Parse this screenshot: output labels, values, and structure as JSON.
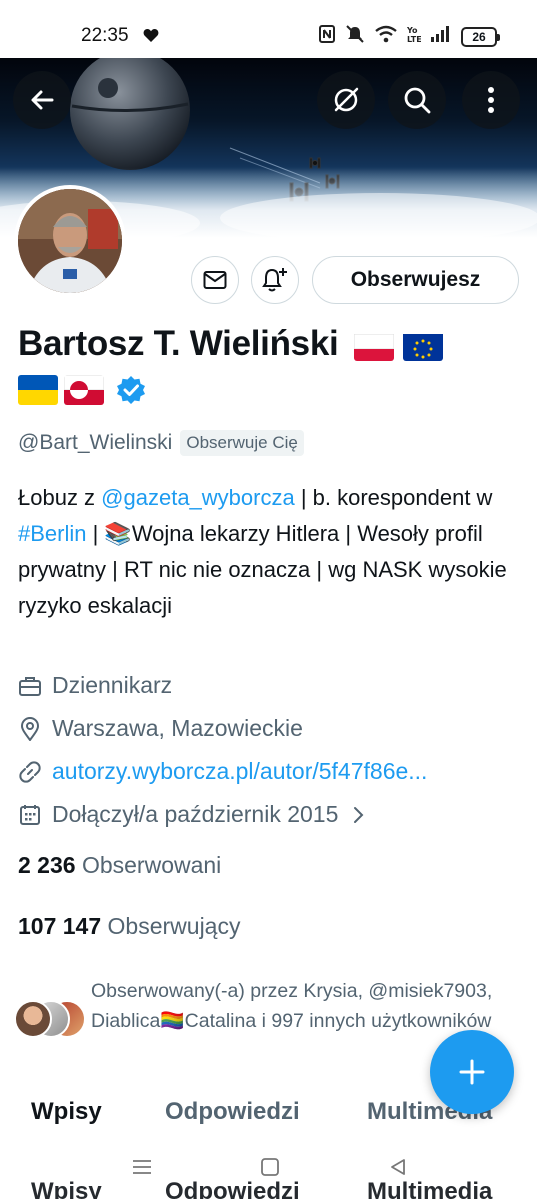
{
  "status_bar": {
    "time": "22:35",
    "battery": "26"
  },
  "profile": {
    "name": "Bartosz T. Wieliński",
    "handle": "@Bart_Wielinski",
    "follows_you_badge": "Obserwuje Cię",
    "follow_button": "Obserwujesz",
    "bio": {
      "p1": "Łobuz z ",
      "mention": "@gazeta_wyborcza",
      "p2": " | b. korespondent w ",
      "hashtag": "#Berlin",
      "p3": " | 📚Wojna lekarzy Hitlera | Wesoły profil prywatny | RT nic nie oznacza | wg NASK wysokie ryzyko eskalacji"
    },
    "profession": "Dziennikarz",
    "location": "Warszawa, Mazowieckie",
    "website": "autorzy.wyborcza.pl/autor/5f47f86e...",
    "joined": "Dołączył/a październik 2015",
    "following_count": "2 236",
    "following_label": "Obserwowani",
    "followers_count": "107 147",
    "followers_label": "Obserwujący",
    "followed_by": "Obserwowany(-a) przez Krysia, @misiek7903, Diablica🏳️‍🌈Catalina i 997 innych użytkowników"
  },
  "tabs": [
    "Wpisy",
    "Odpowiedzi",
    "Multimedia"
  ],
  "colors": {
    "accent": "#1d9bf0",
    "text": "#0f1419",
    "muted": "#536471",
    "border": "#cfd9de"
  }
}
